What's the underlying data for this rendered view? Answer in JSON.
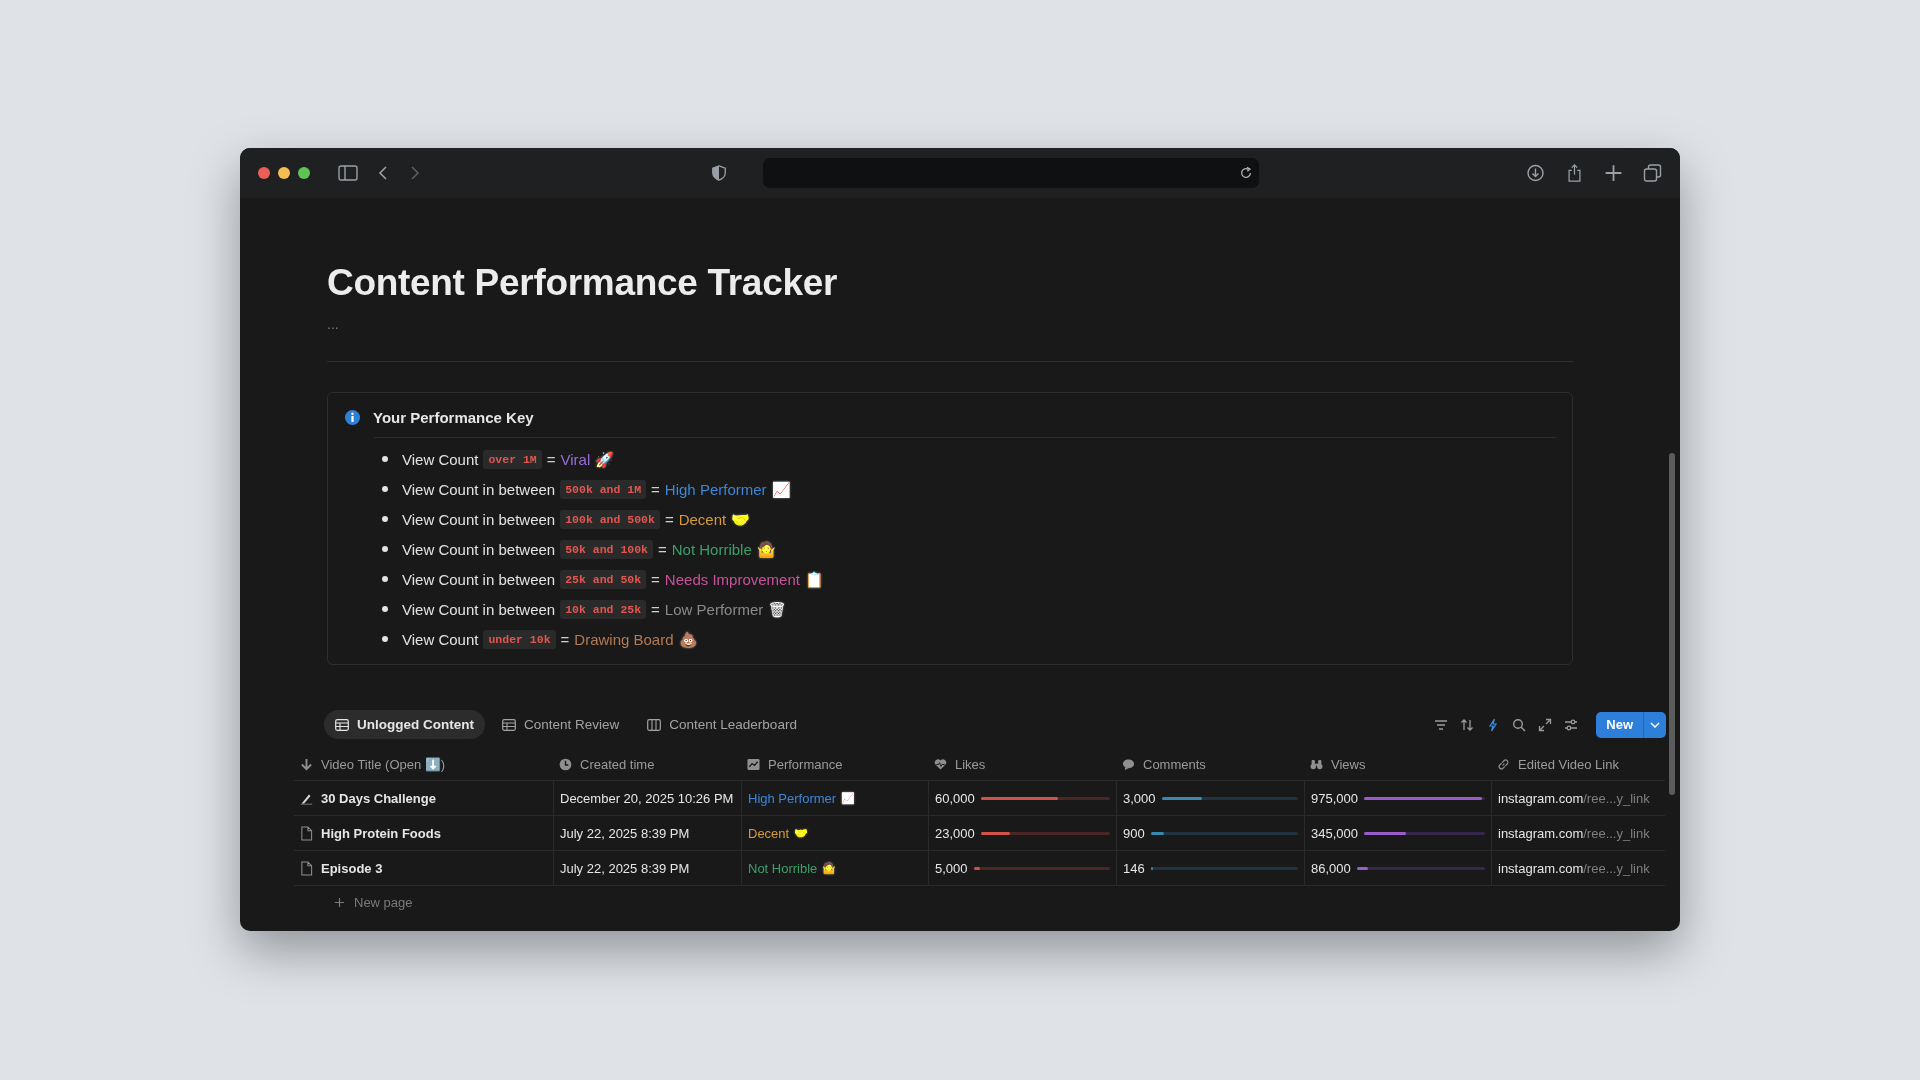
{
  "title": "Content Performance Tracker",
  "title_menu": "...",
  "callout": {
    "title": "Your Performance Key",
    "items": [
      {
        "prefix": "View Count",
        "code": "over 1M",
        "op": "=",
        "label": "Viral",
        "emoji": "🚀",
        "color": "#9a6dd7"
      },
      {
        "prefix": "View Count in between",
        "code": "500k and 1M",
        "op": "=",
        "label": "High Performer",
        "emoji": "📈",
        "color": "#3e86d8"
      },
      {
        "prefix": "View Count in between",
        "code": "100k and 500k",
        "op": "=",
        "label": "Decent",
        "emoji": "🤝",
        "color": "#d59b3a"
      },
      {
        "prefix": "View Count in between",
        "code": "50k and 100k",
        "op": "=",
        "label": "Not Horrible",
        "emoji": "🤷",
        "color": "#3f9f6a"
      },
      {
        "prefix": "View Count in between",
        "code": "25k and 50k",
        "op": "=",
        "label": "Needs Improvement",
        "emoji": "📋",
        "color": "#c9529b"
      },
      {
        "prefix": "View Count in between",
        "code": "10k and 25k",
        "op": "=",
        "label": "Low Performer",
        "emoji": "🗑",
        "color": "#8a8a8a"
      },
      {
        "prefix": "View Count",
        "code": "under 10k",
        "op": "=",
        "label": "Drawing Board",
        "emoji": "💩",
        "color": "#b47a57"
      }
    ]
  },
  "tabs": [
    {
      "label": "Unlogged Content",
      "kind": "table",
      "selected": true
    },
    {
      "label": "Content Review",
      "kind": "table",
      "selected": false
    },
    {
      "label": "Content Leaderboard",
      "kind": "board",
      "selected": false
    }
  ],
  "new_button": "New",
  "columns": [
    {
      "label": "Video Title (Open ⬇️)",
      "kind": "arrow"
    },
    {
      "label": "Created time",
      "kind": "clock"
    },
    {
      "label": "Performance",
      "kind": "chart"
    },
    {
      "label": "Likes",
      "kind": "heart"
    },
    {
      "label": "Comments",
      "kind": "comment"
    },
    {
      "label": "Views",
      "kind": "binoculars"
    },
    {
      "label": "Edited Video Link",
      "kind": "link"
    }
  ],
  "rows": [
    {
      "kind": "pen",
      "title": "30 Days Challenge",
      "created": "December 20, 2025 10:26 PM",
      "performance": {
        "label": "High Performer",
        "emoji": "📈",
        "color": "#3e86d8"
      },
      "likes": {
        "value": "60,000",
        "level": 0.6
      },
      "comments": {
        "value": "3,000",
        "level": 0.3
      },
      "views": {
        "value": "975,000",
        "level": 0.975
      },
      "link": {
        "domain": "instagram.com",
        "path": "/ree...y_link"
      }
    },
    {
      "kind": "page",
      "title": "High Protein Foods",
      "created": "July 22, 2025 8:39 PM",
      "performance": {
        "label": "Decent",
        "emoji": "🤝",
        "color": "#d59b3a"
      },
      "likes": {
        "value": "23,000",
        "level": 0.23
      },
      "comments": {
        "value": "900",
        "level": 0.09
      },
      "views": {
        "value": "345,000",
        "level": 0.345
      },
      "link": {
        "domain": "instagram.com",
        "path": "/ree...y_link"
      }
    },
    {
      "kind": "page",
      "title": "Episode 3",
      "created": "July 22, 2025 8:39 PM",
      "performance": {
        "label": "Not Horrible",
        "emoji": "🤷",
        "color": "#3f9f6a"
      },
      "likes": {
        "value": "5,000",
        "level": 0.05
      },
      "comments": {
        "value": "146",
        "level": 0.015
      },
      "views": {
        "value": "86,000",
        "level": 0.086
      },
      "link": {
        "domain": "instagram.com",
        "path": "/ree...y_link"
      }
    }
  ],
  "new_page": "New page"
}
